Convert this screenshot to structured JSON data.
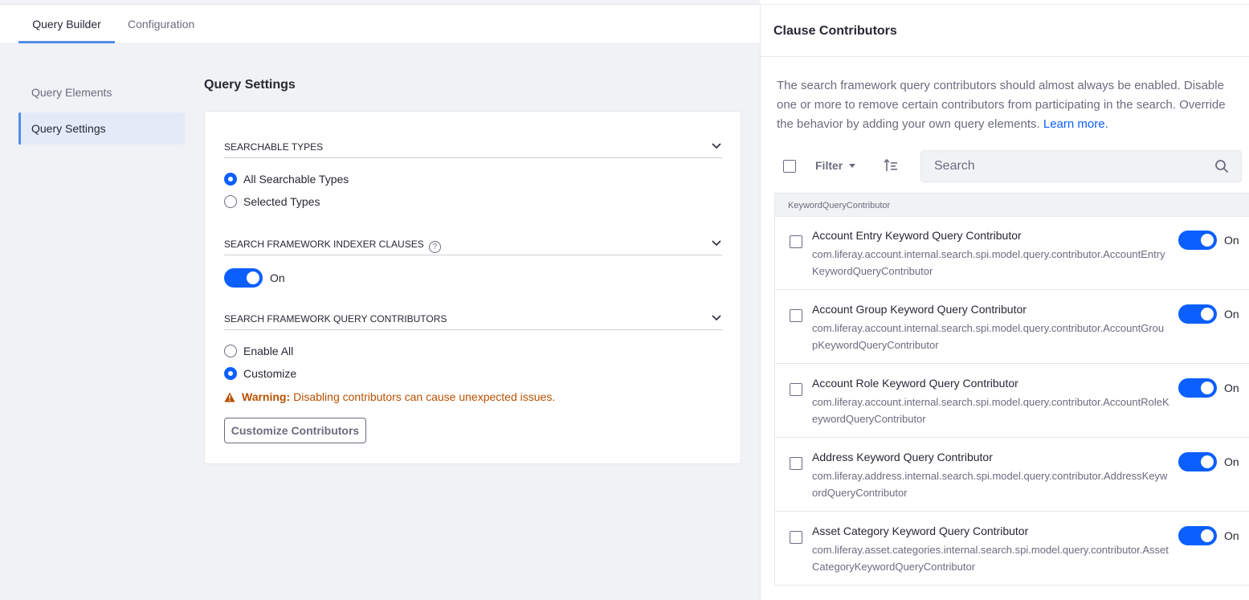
{
  "tabs": [
    {
      "label": "Query Builder",
      "active": true
    },
    {
      "label": "Configuration",
      "active": false
    }
  ],
  "sidebar": {
    "items": [
      {
        "label": "Query Elements",
        "active": false
      },
      {
        "label": "Query Settings",
        "active": true
      }
    ]
  },
  "main": {
    "title": "Query Settings",
    "searchable_types": {
      "heading": "SEARCHABLE TYPES",
      "options": [
        {
          "label": "All Searchable Types",
          "checked": true
        },
        {
          "label": "Selected Types",
          "checked": false
        }
      ]
    },
    "indexer_clauses": {
      "heading": "SEARCH FRAMEWORK INDEXER CLAUSES",
      "help_glyph": "?",
      "toggle_label": "On"
    },
    "query_contributors": {
      "heading": "SEARCH FRAMEWORK QUERY CONTRIBUTORS",
      "options": [
        {
          "label": "Enable All",
          "checked": false
        },
        {
          "label": "Customize",
          "checked": true
        }
      ],
      "warning_title": "Warning:",
      "warning_text": "Disabling contributors can cause unexpected issues.",
      "button_label": "Customize Contributors"
    }
  },
  "panel": {
    "title": "Clause Contributors",
    "description": "The search framework query contributors should almost always be enabled. Disable one or more to remove certain contributors from participating in the search. Override the behavior by adding your own query elements.",
    "learn_more": "Learn more.",
    "filter_label": "Filter",
    "search_placeholder": "Search",
    "group_label": "KeywordQueryContributor",
    "rows": [
      {
        "title": "Account Entry Keyword Query Contributor",
        "class_name": "com.liferay.account.internal.search.spi.model.query.contributor.AccountEntryKeywordQueryContributor",
        "toggle": "On"
      },
      {
        "title": "Account Group Keyword Query Contributor",
        "class_name": "com.liferay.account.internal.search.spi.model.query.contributor.AccountGroupKeywordQueryContributor",
        "toggle": "On"
      },
      {
        "title": "Account Role Keyword Query Contributor",
        "class_name": "com.liferay.account.internal.search.spi.model.query.contributor.AccountRoleKeywordQueryContributor",
        "toggle": "On"
      },
      {
        "title": "Address Keyword Query Contributor",
        "class_name": "com.liferay.address.internal.search.spi.model.query.contributor.AddressKeywordQueryContributor",
        "toggle": "On"
      },
      {
        "title": "Asset Category Keyword Query Contributor",
        "class_name": "com.liferay.asset.categories.internal.search.spi.model.query.contributor.AssetCategoryKeywordQueryContributor",
        "toggle": "On"
      }
    ]
  },
  "colors": {
    "accent": "#0b5fff",
    "tab_indicator": "#528ce8",
    "warning": "#b95000",
    "background": "#f1f2f5"
  }
}
